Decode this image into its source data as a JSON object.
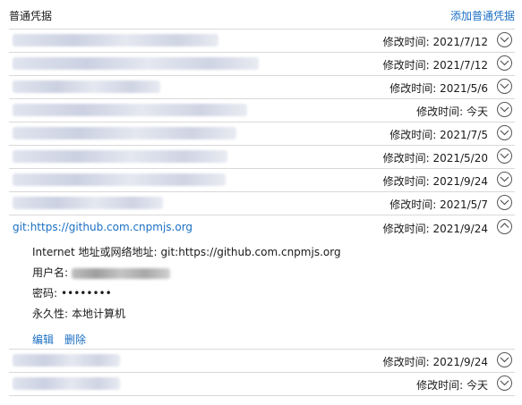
{
  "header": {
    "title": "普通凭据",
    "add_label": "添加普通凭据"
  },
  "collapsed_rows_top": [
    {
      "date": "修改时间:  2021/7/12"
    },
    {
      "date": "修改时间:  2021/7/12"
    },
    {
      "date": "修改时间:  2021/5/6"
    },
    {
      "date": "修改时间:  今天"
    },
    {
      "date": "修改时间:  2021/7/5"
    },
    {
      "date": "修改时间:  2021/5/20"
    },
    {
      "date": "修改时间:  2021/9/24"
    },
    {
      "date": "修改时间:  2021/5/7"
    }
  ],
  "expanded": {
    "name": "git:https://github.com.cnpmjs.org",
    "date": "修改时间:  2021/9/24",
    "address_label": "Internet 地址或网络地址:",
    "address_value": "git:https://github.com.cnpmjs.org",
    "username_label": "用户名:",
    "password_label": "密码:",
    "password_value": "••••••••",
    "persistence_label": "永久性:",
    "persistence_value": "本地计算机",
    "edit_label": "编辑",
    "delete_label": "删除"
  },
  "collapsed_rows_bottom": [
    {
      "date": "修改时间:  2021/9/24"
    },
    {
      "date": "修改时间:  今天"
    }
  ],
  "icons": {
    "expand": "chevron-down-icon",
    "collapse": "chevron-up-icon"
  },
  "colors": {
    "link": "#1a6fc3",
    "divider": "#d9d9d9"
  }
}
